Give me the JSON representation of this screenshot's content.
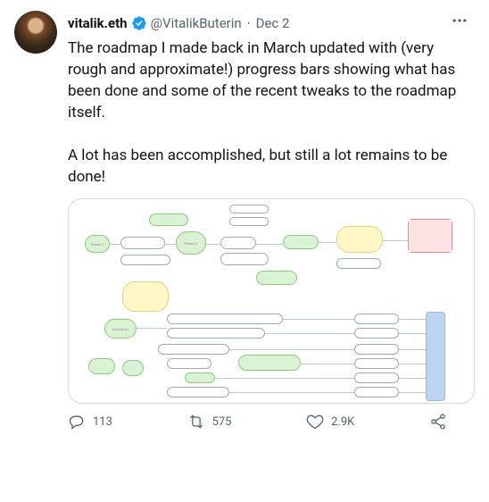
{
  "header": {
    "display_name": "vitalik.eth",
    "handle": "@VitalikButerin",
    "separator": "·",
    "date": "Dec 2"
  },
  "tweet_text": "The roadmap I made back in March updated with (very rough and approximate!) progress bars showing what has been done and some of the recent tweaks to the roadmap itself.\n\nA lot has been accomplished, but still a lot remains to be done!",
  "actions": {
    "replies": "113",
    "retweets": "575",
    "likes": "2.9K"
  },
  "colors": {
    "verified": "#1d9bf0",
    "gray": "#536471"
  }
}
